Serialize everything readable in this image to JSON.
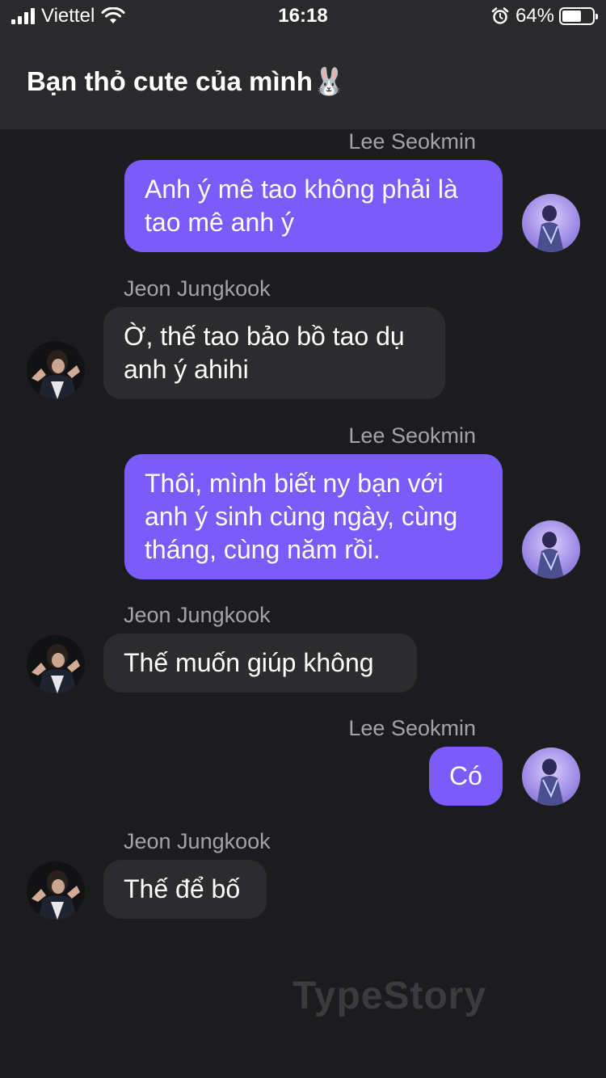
{
  "status_bar": {
    "carrier": "Viettel",
    "time": "16:18",
    "battery_percent": "64%",
    "battery_level": 0.64
  },
  "header": {
    "title": "Bạn thỏ cute của mình🐰"
  },
  "messages": [
    {
      "sender": "Lee Seokmin",
      "direction": "outgoing",
      "text": "Anh ý mê tao không phải là tao mê anh ý"
    },
    {
      "sender": "Jeon Jungkook",
      "direction": "incoming",
      "text": "Ờ, thế tao bảo bồ tao dụ anh ý ahihi"
    },
    {
      "sender": "Lee Seokmin",
      "direction": "outgoing",
      "text": "Thôi, mình biết ny bạn với anh ý sinh cùng ngày, cùng tháng, cùng năm rồi."
    },
    {
      "sender": "Jeon Jungkook",
      "direction": "incoming",
      "text": "Thế muốn giúp không"
    },
    {
      "sender": "Lee Seokmin",
      "direction": "outgoing",
      "text": "Có"
    },
    {
      "sender": "Jeon Jungkook",
      "direction": "incoming",
      "text": "Thế để bố"
    }
  ],
  "watermark": "TypeStory",
  "colors": {
    "outgoing_bubble": "#7b5cfa",
    "incoming_bubble": "#2c2c2e",
    "background": "#1c1c1e",
    "header": "#2a2a2c"
  }
}
